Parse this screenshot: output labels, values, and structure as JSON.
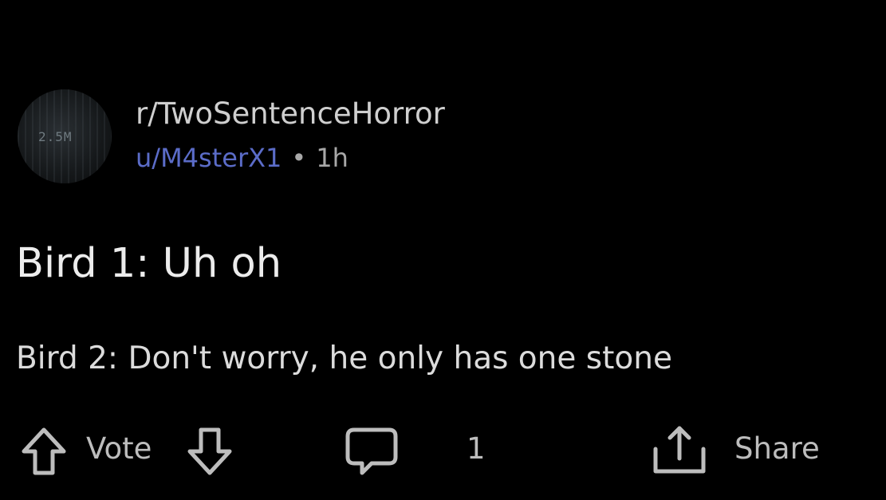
{
  "post": {
    "avatar_text": "2.5M",
    "subreddit": "r/TwoSentenceHorror",
    "username": "u/M4sterX1",
    "separator": "•",
    "time": "1h",
    "title": "Bird 1: Uh oh",
    "body": "Bird 2: Don't worry, he only has one stone"
  },
  "actions": {
    "vote_label": "Vote",
    "comment_count": "1",
    "share_label": "Share"
  },
  "colors": {
    "background": "#000000",
    "username": "#5b6cc8",
    "text": "#e6e6e6",
    "muted": "#a8a8a8"
  },
  "icons": [
    "upvote-icon",
    "downvote-icon",
    "comment-icon",
    "share-icon"
  ]
}
